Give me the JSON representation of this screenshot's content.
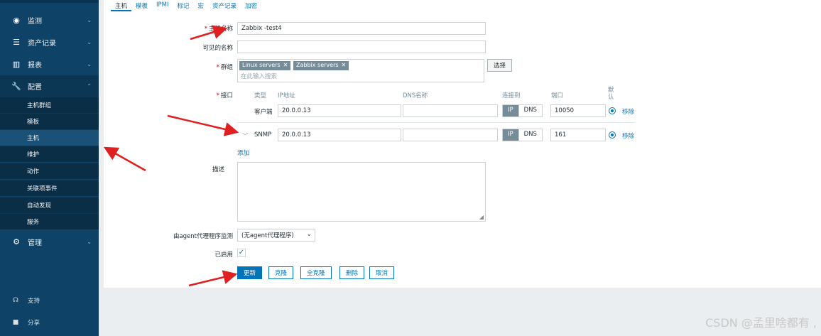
{
  "sidebar": {
    "items": [
      {
        "label": "监测",
        "icon": "eye-icon"
      },
      {
        "label": "资产记录",
        "icon": "list-icon"
      },
      {
        "label": "报表",
        "icon": "bar-chart-icon"
      },
      {
        "label": "配置",
        "icon": "wrench-icon"
      },
      {
        "label": "管理",
        "icon": "gear-icon"
      }
    ],
    "subitems": [
      "主机群组",
      "模板",
      "主机",
      "维护",
      "动作",
      "关联项事件",
      "自动发现",
      "服务"
    ],
    "active_sub": "主机",
    "footer": [
      {
        "label": "支持",
        "icon": "headset-icon"
      },
      {
        "label": "分享",
        "icon": "share-icon"
      }
    ]
  },
  "tabs": [
    "主机",
    "模板",
    "IPMI",
    "标记",
    "宏",
    "资产记录",
    "加密"
  ],
  "form": {
    "hostname_label": "主机名称",
    "hostname_value": "Zabbix -test4",
    "visible_label": "可见的名称",
    "visible_value": "",
    "groups_label": "群组",
    "groups": [
      "Linux servers",
      "Zabbix servers"
    ],
    "groups_placeholder": "在此输入搜索",
    "select_button": "选择",
    "interfaces_label": "接口",
    "iface_headers": {
      "type": "类型",
      "ip": "IP地址",
      "dns": "DNS名称",
      "connect": "连接到",
      "port": "端口",
      "default": "默认"
    },
    "interfaces": [
      {
        "type": "客户端",
        "ip": "20.0.0.13",
        "dns": "",
        "conn_ip": "IP",
        "conn_dns": "DNS",
        "port": "10050",
        "remove": "移除"
      },
      {
        "type": "SNMP",
        "ip": "20.0.0.13",
        "dns": "",
        "conn_ip": "IP",
        "conn_dns": "DNS",
        "port": "161",
        "remove": "移除"
      }
    ],
    "add_link": "添加",
    "description_label": "描述",
    "proxy_label": "由agent代理程序监测",
    "proxy_value": "(无agent代理程序)",
    "enabled_label": "已启用",
    "buttons": {
      "update": "更新",
      "clone": "克隆",
      "full_clone": "全克隆",
      "delete": "删除",
      "cancel": "取消"
    }
  },
  "watermark": "CSDN @孟里啥都有 ,"
}
